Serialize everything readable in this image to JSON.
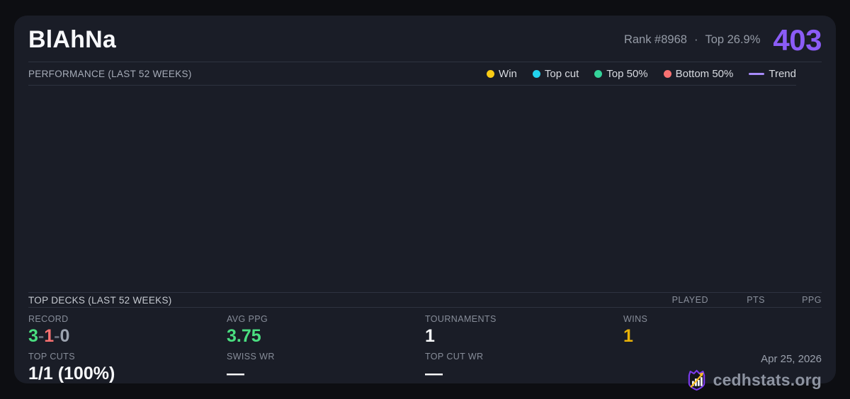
{
  "header": {
    "title": "BlAhNa",
    "rank_label": "Rank #8968",
    "separator": "·",
    "percentile_label": "Top 26.9%",
    "points": "403"
  },
  "performance": {
    "heading": "PERFORMANCE (LAST 52 WEEKS)",
    "legend": [
      {
        "label": "Win",
        "color": "#facc15",
        "marker": "dot"
      },
      {
        "label": "Top cut",
        "color": "#22d3ee",
        "marker": "dot"
      },
      {
        "label": "Top 50%",
        "color": "#34d399",
        "marker": "dot"
      },
      {
        "label": "Bottom 50%",
        "color": "#f87171",
        "marker": "dot"
      },
      {
        "label": "Trend",
        "color": "#a78bfa",
        "marker": "line"
      }
    ],
    "chart_points": []
  },
  "top_decks": {
    "heading": "TOP DECKS (LAST 52 WEEKS)",
    "columns": [
      "PLAYED",
      "PTS",
      "PPG"
    ],
    "rows": []
  },
  "stats": {
    "record": {
      "label": "RECORD",
      "wins": "3",
      "losses": "1",
      "draws": "0",
      "dash": "-"
    },
    "avg_ppg": {
      "label": "AVG PPG",
      "value": "3.75"
    },
    "tournaments": {
      "label": "TOURNAMENTS",
      "value": "1"
    },
    "wins": {
      "label": "WINS",
      "value": "1"
    },
    "top_cuts": {
      "label": "TOP CUTS",
      "value": "1/1 (100%)"
    },
    "swiss_wr": {
      "label": "SWISS WR",
      "value": "—"
    },
    "top_cut_wr": {
      "label": "TOP CUT WR",
      "value": "—"
    }
  },
  "footer": {
    "date": "Apr 25, 2026",
    "site": "cedhstats.org"
  },
  "colors": {
    "points": "#8b5cf6",
    "win_green": "#4ade80",
    "loss_red": "#f87171",
    "draw_gray": "#9ca3af",
    "ppg_green": "#4ade80",
    "wins_yellow": "#eab308",
    "logo_purple": "#7c3aed",
    "logo_arrow": "#fbbf24"
  }
}
